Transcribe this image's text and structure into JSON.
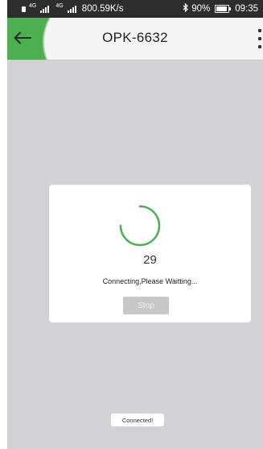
{
  "status_bar": {
    "net_label_1": "4G",
    "net_label_2": "4G",
    "speed": "800.59K/s",
    "bluetooth_icon": "bluetooth-icon",
    "battery_percent": "90%",
    "battery_level": 0.9,
    "time": "09:35"
  },
  "header": {
    "title": "OPK-6632",
    "back_icon": "arrow-left-icon",
    "menu_icon": "more-vertical-icon",
    "accent_color": "#4caf50"
  },
  "dialog": {
    "count": "29",
    "message": "Connecting,Please Waitting...",
    "stop_label": "Stop",
    "spinner_icon": "loading-spinner-icon"
  },
  "toast": {
    "text": "Connected!"
  }
}
